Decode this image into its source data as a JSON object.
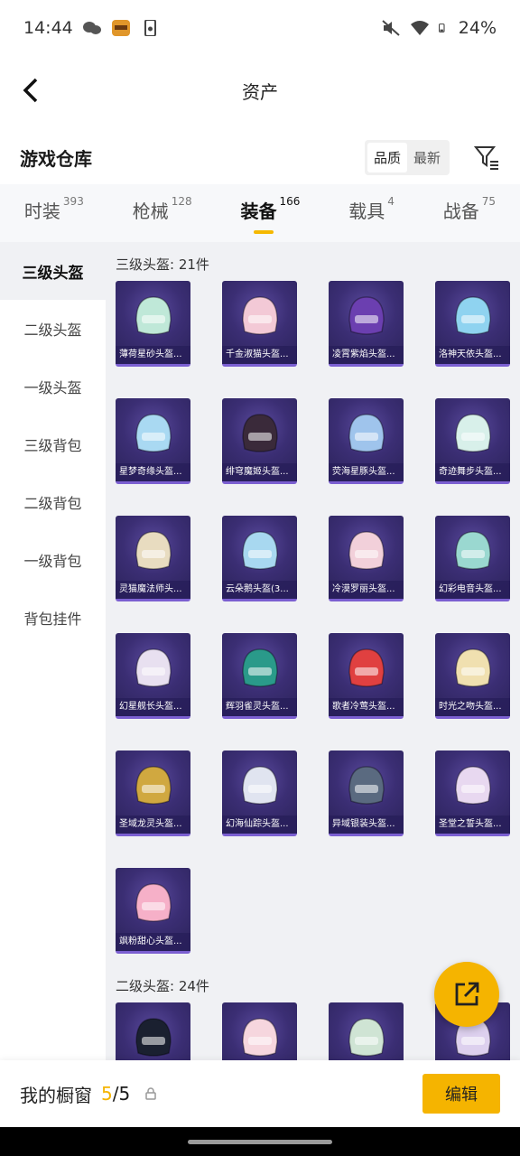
{
  "status": {
    "time": "14:44",
    "battery": "24%"
  },
  "header": {
    "title": "资产"
  },
  "repo": {
    "title": "游戏仓库",
    "sort_options": [
      "品质",
      "最新"
    ],
    "active_sort": 1
  },
  "tabs": [
    {
      "label": "时装",
      "count": "393"
    },
    {
      "label": "枪械",
      "count": "128"
    },
    {
      "label": "装备",
      "count": "166"
    },
    {
      "label": "载具",
      "count": "4"
    },
    {
      "label": "战备",
      "count": "75"
    }
  ],
  "sidebar": {
    "items": [
      {
        "label": "三级头盔"
      },
      {
        "label": "二级头盔"
      },
      {
        "label": "一级头盔"
      },
      {
        "label": "三级背包"
      },
      {
        "label": "二级背包"
      },
      {
        "label": "一级背包"
      },
      {
        "label": "背包挂件"
      }
    ]
  },
  "sections": [
    {
      "label": "三级头盔: 21件",
      "items": [
        {
          "name": "薄荷星砂头盔...",
          "color": "#bfe8d8"
        },
        {
          "name": "千金淑猫头盔...",
          "color": "#f3c9d6"
        },
        {
          "name": "凌霄紫焰头盔...",
          "color": "#6b3fb0"
        },
        {
          "name": "洛神天依头盔...",
          "color": "#8fd3f0"
        },
        {
          "name": "星梦奇缘头盔...",
          "color": "#a9d9f2"
        },
        {
          "name": "绯穹魔姬头盔...",
          "color": "#3a2a3a"
        },
        {
          "name": "荧海星豚头盔...",
          "color": "#9fc4ec"
        },
        {
          "name": "奇迹舞步头盔...",
          "color": "#d8f0ea"
        },
        {
          "name": "灵猫魔法师头...",
          "color": "#e8dcc0"
        },
        {
          "name": "云朵鹅头盔(3...",
          "color": "#a8d8f0"
        },
        {
          "name": "冷漠罗丽头盔...",
          "color": "#f2d0da"
        },
        {
          "name": "幻彩电音头盔...",
          "color": "#9ad8d0"
        },
        {
          "name": "幻星舰长头盔...",
          "color": "#e8e0f0"
        },
        {
          "name": "辉羽雀灵头盔...",
          "color": "#2a9a8a"
        },
        {
          "name": "歌者冷莺头盔...",
          "color": "#e04040"
        },
        {
          "name": "时光之吻头盔...",
          "color": "#f0e0b0"
        },
        {
          "name": "圣域龙灵头盔...",
          "color": "#d0a840"
        },
        {
          "name": "幻海仙踪头盔...",
          "color": "#e0e4f0"
        },
        {
          "name": "异域银装头盔...",
          "color": "#5a6a80"
        },
        {
          "name": "圣堂之誓头盔...",
          "color": "#e8d8f0"
        },
        {
          "name": "飒粉甜心头盔...",
          "color": "#f6b0c8"
        }
      ]
    },
    {
      "label": "二级头盔: 24件",
      "items": [
        {
          "name": "",
          "color": "#1a2030"
        },
        {
          "name": "",
          "color": "#f6d6de"
        },
        {
          "name": "",
          "color": "#cfe4d4"
        },
        {
          "name": "",
          "color": "#ddd0ee"
        }
      ]
    }
  ],
  "bottom": {
    "window_label": "我的橱窗",
    "window_current": "5",
    "window_total": "/5",
    "edit_label": "编辑"
  }
}
